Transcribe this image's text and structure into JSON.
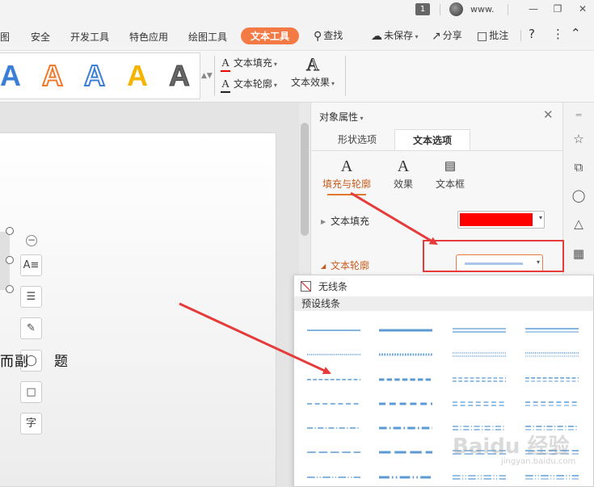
{
  "titlebar": {
    "badge": "1",
    "username": "www.",
    "window_controls": [
      "minimize-icon",
      "restore-icon",
      "close-icon"
    ]
  },
  "menubar": {
    "items": [
      "图",
      "安全",
      "开发工具",
      "特色应用",
      "绘图工具",
      "文本工具"
    ],
    "active": "文本工具",
    "search": "查找",
    "unsaved": "未保存",
    "share": "分享",
    "comment": "批注",
    "help": "?",
    "more": "⋮",
    "collapse": "^"
  },
  "ribbon": {
    "style_samples": [
      "A",
      "A",
      "A",
      "A",
      "A"
    ],
    "text_fill": "文本填充",
    "text_outline": "文本轮廓",
    "text_effect": "文本效果",
    "colors": {
      "blue": "#3a7fd5",
      "orange": "#f07a2b",
      "gold": "#f4b400",
      "gray": "#555555"
    }
  },
  "slide": {
    "visible_text": "而副",
    "visible_text_2": "题",
    "float_tools": [
      "text-wrap-icon",
      "layers-icon",
      "pen-icon",
      "fill-icon",
      "outline-icon",
      "font-icon"
    ]
  },
  "panel": {
    "title": "对象属性",
    "tabs": [
      "形状选项",
      "文本选项"
    ],
    "active_tab": "文本选项",
    "subtabs": [
      "填充与轮廓",
      "效果",
      "文本框"
    ],
    "active_subtab": "填充与轮廓",
    "text_fill_label": "文本填充",
    "text_fill_color": "#ff0000",
    "text_outline_label": "文本轮廓",
    "text_outline_preview_color": "#a9c6e8"
  },
  "popup": {
    "no_line": "无线条",
    "preset_header": "预设线条",
    "line_color": "#5b9bd5",
    "rows": 7,
    "cols": 4
  },
  "right_strip": [
    "star-pin-icon",
    "transform-icon",
    "shape-icon",
    "text-style-icon",
    "table-icon"
  ],
  "watermark": {
    "main": "Baidu 经验",
    "sub": "jingyan.baidu.com"
  },
  "annotation_color": "#e53b3b"
}
